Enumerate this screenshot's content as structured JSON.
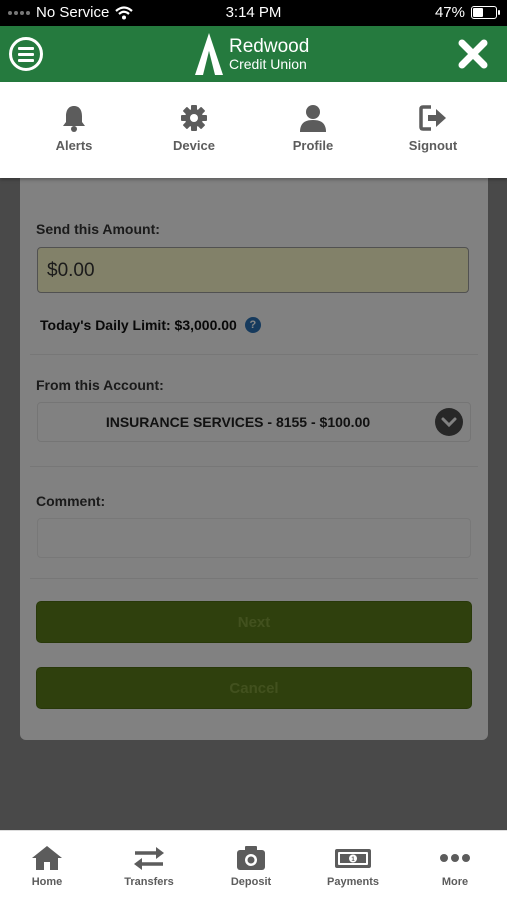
{
  "status_bar": {
    "carrier": "No Service",
    "time": "3:14 PM",
    "battery": "47%",
    "battery_level": 0.47
  },
  "header": {
    "logo_name": "Redwood",
    "logo_sub": "Credit Union",
    "brand_color": "#257a3e"
  },
  "actions": [
    {
      "label": "Alerts",
      "icon": "bell-icon"
    },
    {
      "label": "Device",
      "icon": "gear-icon"
    },
    {
      "label": "Profile",
      "icon": "user-icon"
    },
    {
      "label": "Signout",
      "icon": "signout-icon"
    }
  ],
  "form": {
    "amount_label": "Send this Amount:",
    "amount_value": "$0.00",
    "daily_limit": "Today's Daily Limit: $3,000.00",
    "from_label": "From this Account:",
    "from_value": "INSURANCE SERVICES - 8155 - $100.00",
    "comment_label": "Comment:",
    "comment_value": "",
    "next_label": "Next",
    "cancel_label": "Cancel"
  },
  "tabs": [
    {
      "label": "Home",
      "icon": "home-icon"
    },
    {
      "label": "Transfers",
      "icon": "transfer-icon"
    },
    {
      "label": "Deposit",
      "icon": "camera-icon"
    },
    {
      "label": "Payments",
      "icon": "money-icon"
    },
    {
      "label": "More",
      "icon": "more-icon"
    }
  ]
}
